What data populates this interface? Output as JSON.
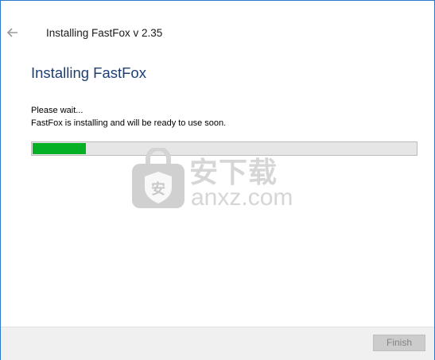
{
  "window": {
    "title": "Installing FastFox v 2.35"
  },
  "main": {
    "heading": "Installing FastFox",
    "message_line1": "Please wait...",
    "message_line2": "FastFox is installing and will be ready to use soon.",
    "progress_fraction": 0.14
  },
  "footer": {
    "finish_label": "Finish"
  },
  "watermark": {
    "text_cn": "安下载",
    "text_en": "anxz.com"
  },
  "icons": {
    "back": "back-arrow-icon",
    "watermark": "shield-lock-icon"
  },
  "colors": {
    "accent": "#1f3f73",
    "progress": "#06b025",
    "border": "#2b79c8"
  }
}
